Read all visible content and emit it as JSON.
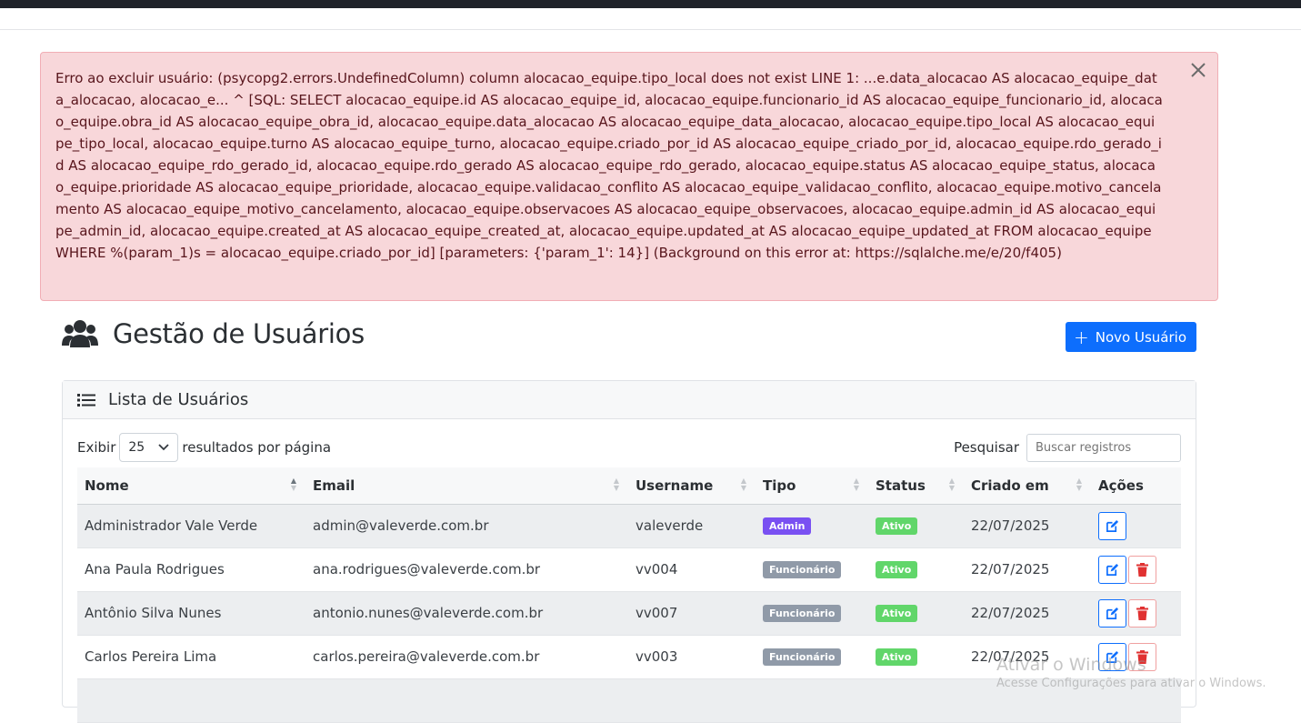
{
  "alert": {
    "message": "Erro ao excluir usuário: (psycopg2.errors.UndefinedColumn) column alocacao_equipe.tipo_local does not exist LINE 1: ...e.data_alocacao AS alocacao_equipe_data_alocacao, alocacao_e... ^ [SQL: SELECT alocacao_equipe.id AS alocacao_equipe_id, alocacao_equipe.funcionario_id AS alocacao_equipe_funcionario_id, alocacao_equipe.obra_id AS alocacao_equipe_obra_id, alocacao_equipe.data_alocacao AS alocacao_equipe_data_alocacao, alocacao_equipe.tipo_local AS alocacao_equipe_tipo_local, alocacao_equipe.turno AS alocacao_equipe_turno, alocacao_equipe.criado_por_id AS alocacao_equipe_criado_por_id, alocacao_equipe.rdo_gerado_id AS alocacao_equipe_rdo_gerado_id, alocacao_equipe.rdo_gerado AS alocacao_equipe_rdo_gerado, alocacao_equipe.status AS alocacao_equipe_status, alocacao_equipe.prioridade AS alocacao_equipe_prioridade, alocacao_equipe.validacao_conflito AS alocacao_equipe_validacao_conflito, alocacao_equipe.motivo_cancelamento AS alocacao_equipe_motivo_cancelamento, alocacao_equipe.observacoes AS alocacao_equipe_observacoes, alocacao_equipe.admin_id AS alocacao_equipe_admin_id, alocacao_equipe.created_at AS alocacao_equipe_created_at, alocacao_equipe.updated_at AS alocacao_equipe_updated_at FROM alocacao_equipe WHERE %(param_1)s = alocacao_equipe.criado_por_id] [parameters: {'param_1': 14}] (Background on this error at: https://sqlalche.me/e/20/f405)",
    "close_icon": "close-icon"
  },
  "header": {
    "icon": "users-icon",
    "title": "Gestão de Usuários",
    "new_button": "Novo Usuário"
  },
  "card": {
    "icon": "list-icon",
    "title": "Lista de Usuários"
  },
  "controls": {
    "show_label": "Exibir",
    "page_size": "25",
    "per_page_label": "resultados por página",
    "search_label": "Pesquisar",
    "search_placeholder": "Buscar registros"
  },
  "table": {
    "columns": [
      "Nome",
      "Email",
      "Username",
      "Tipo",
      "Status",
      "Criado em",
      "Ações"
    ],
    "rows": [
      {
        "nome": "Administrador Vale Verde",
        "email": "admin@valeverde.com.br",
        "username": "valeverde",
        "tipo": "Admin",
        "status": "Ativo",
        "criado": "22/07/2025"
      },
      {
        "nome": "Ana Paula Rodrigues",
        "email": "ana.rodrigues@valeverde.com.br",
        "username": "vv004",
        "tipo": "Funcionário",
        "status": "Ativo",
        "criado": "22/07/2025"
      },
      {
        "nome": "Antônio Silva Nunes",
        "email": "antonio.nunes@valeverde.com.br",
        "username": "vv007",
        "tipo": "Funcionário",
        "status": "Ativo",
        "criado": "22/07/2025"
      },
      {
        "nome": "Carlos Pereira Lima",
        "email": "carlos.pereira@valeverde.com.br",
        "username": "vv003",
        "tipo": "Funcionário",
        "status": "Ativo",
        "criado": "22/07/2025"
      }
    ]
  },
  "watermark": {
    "line1": "Ativar o Windows",
    "line2": "Acesse Configurações para ativar o Windows."
  },
  "colors": {
    "primary": "#0d6efd",
    "alert_bg": "#f8d7da",
    "admin_badge": "#7950f2",
    "func_badge": "#909aa8",
    "ativo_badge": "#61d66a",
    "danger": "#e03131"
  }
}
